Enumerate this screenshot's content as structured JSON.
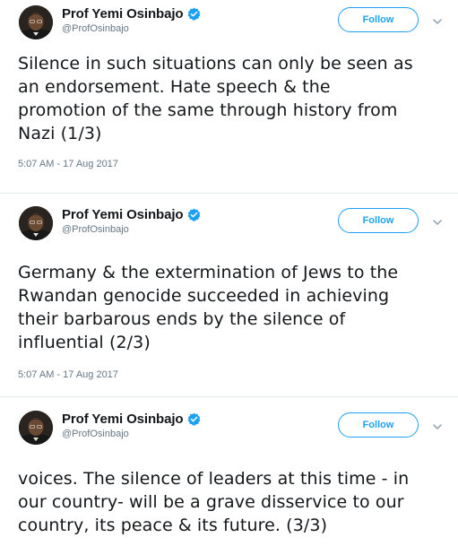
{
  "tweets": [
    {
      "author": {
        "name": "Prof Yemi Osinbajo",
        "handle": "@ProfOsinbajo",
        "verified": true
      },
      "follow_label": "Follow",
      "text": "Silence in such situations can only be seen as\nan endorsement. Hate speech & the\npromotion of the same through history from\nNazi (1/3)",
      "timestamp": "5:07 AM - 17 Aug 2017"
    },
    {
      "author": {
        "name": "Prof Yemi Osinbajo",
        "handle": "@ProfOsinbajo",
        "verified": true
      },
      "follow_label": "Follow",
      "text": "Germany & the extermination of Jews to the\nRwandan genocide succeeded in achieving\ntheir barbarous ends by the silence of\ninfluential (2/3)",
      "timestamp": "5:07 AM - 17 Aug 2017"
    },
    {
      "author": {
        "name": "Prof Yemi Osinbajo",
        "handle": "@ProfOsinbajo",
        "verified": true
      },
      "follow_label": "Follow",
      "text": "voices. The silence of leaders at this time - in\nour country- will be a grave disservice to our\ncountry, its peace & its future. (3/3)"
    }
  ],
  "colors": {
    "accent": "#1da1f2",
    "text": "#14171a",
    "secondary": "#657786",
    "divider": "#e6ecf0"
  },
  "icons": {
    "verified": "verified-badge-icon",
    "more": "chevron-down-icon",
    "avatar": "profile-photo"
  }
}
